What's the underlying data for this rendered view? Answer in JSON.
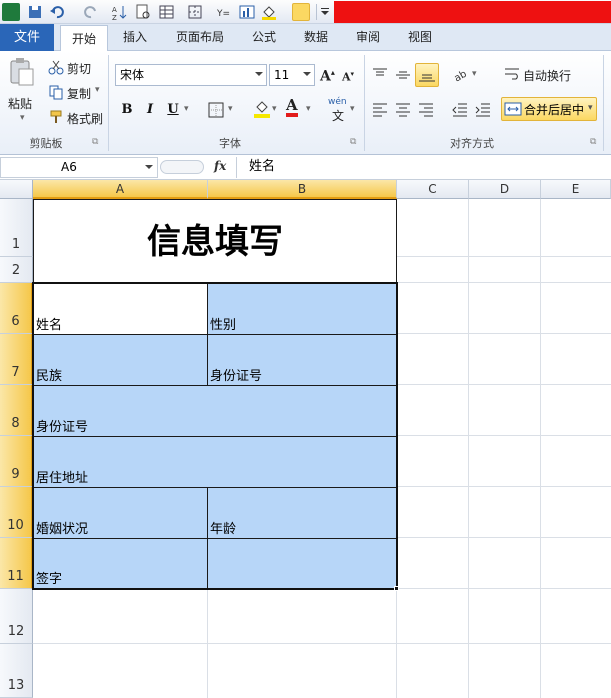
{
  "qat": {
    "red_banner": ""
  },
  "ribbon_tabs": {
    "file": "文件",
    "items": [
      "开始",
      "插入",
      "页面布局",
      "公式",
      "数据",
      "审阅",
      "视图"
    ],
    "active": "开始"
  },
  "clipboard": {
    "paste": "粘贴",
    "cut": "剪切",
    "copy": "复制",
    "format_painter": "格式刷",
    "label": "剪贴板"
  },
  "font": {
    "name": "宋体",
    "size": "11",
    "label": "字体",
    "bold": "B",
    "italic": "I",
    "underline": "U",
    "font_color": "A",
    "phonetic": "wén"
  },
  "alignment": {
    "wrap_text": "自动换行",
    "merge_center": "合并后居中",
    "label": "对齐方式"
  },
  "formula_bar": {
    "name_box": "A6",
    "fx": "fx",
    "content": "姓名"
  },
  "grid": {
    "columns": [
      "A",
      "B",
      "C",
      "D",
      "E"
    ],
    "rows": [
      "1",
      "2",
      "6",
      "7",
      "8",
      "9",
      "10",
      "11",
      "12",
      "13"
    ],
    "title": "信息填写",
    "fields": {
      "name": "姓名",
      "gender": "性别",
      "ethnicity": "民族",
      "id_b": "身份证号",
      "id_row": "身份证号",
      "address": "居住地址",
      "marital": "婚姻状况",
      "age": "年龄",
      "signature": "签字"
    }
  },
  "colors": {
    "selection_fill": "#b7d6f8",
    "header_selected": "#f5c74a",
    "file_tab": "#2a66b8",
    "red_banner": "#ee1111"
  }
}
